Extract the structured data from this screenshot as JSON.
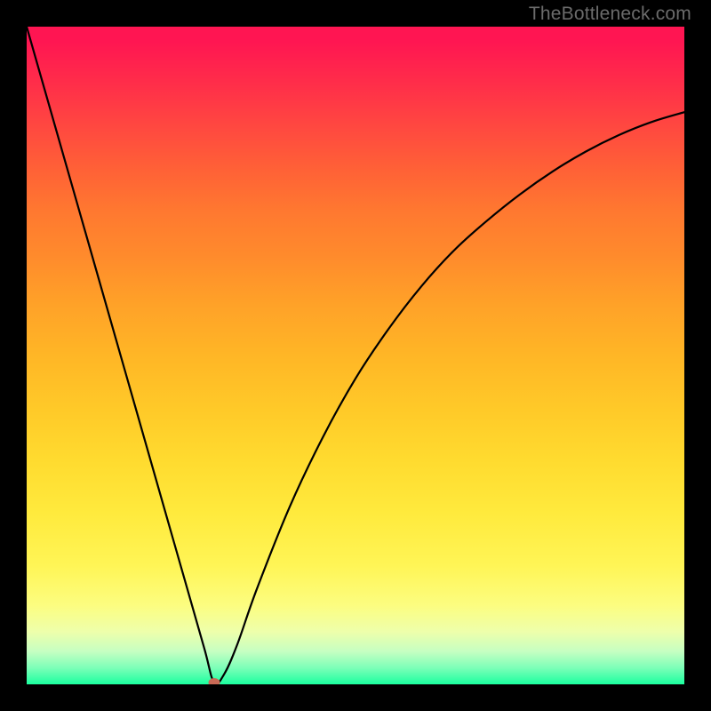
{
  "watermark": "TheBottleneck.com",
  "chart_data": {
    "type": "line",
    "title": "",
    "xlabel": "",
    "ylabel": "",
    "xlim": [
      0,
      100
    ],
    "ylim": [
      0,
      100
    ],
    "grid": false,
    "legend": false,
    "series": [
      {
        "name": "bottleneck-curve",
        "x": [
          0,
          3,
          6,
          9,
          12,
          15,
          18,
          21,
          24,
          27,
          28.5,
          30,
          32,
          35,
          40,
          45,
          50,
          55,
          60,
          65,
          70,
          75,
          80,
          85,
          90,
          95,
          100
        ],
        "values": [
          100,
          89.5,
          79,
          68.5,
          58,
          47.5,
          37,
          26.5,
          16,
          5.5,
          0.3,
          1.5,
          6,
          14.5,
          27,
          37.5,
          46.5,
          54,
          60.5,
          66,
          70.5,
          74.5,
          78,
          81,
          83.5,
          85.5,
          87
        ]
      }
    ],
    "marker": {
      "x": 28.5,
      "y": 0.3,
      "color": "#c96a56"
    },
    "background_gradient": {
      "top": "#ff1552",
      "mid": "#ffea3d",
      "bottom": "#1bff9f"
    }
  }
}
